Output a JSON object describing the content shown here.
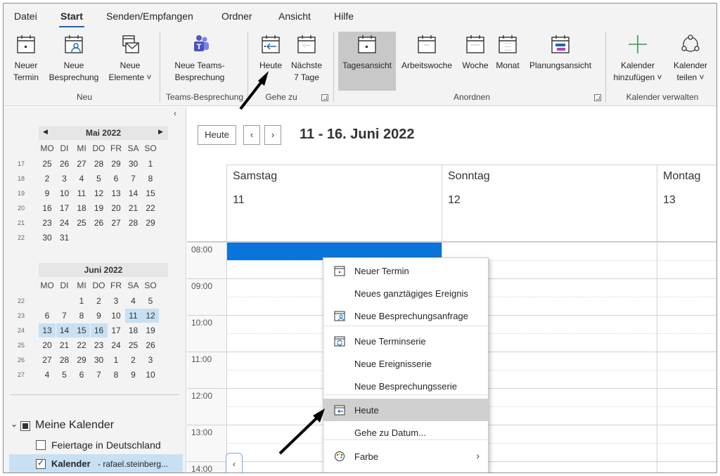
{
  "tabs": [
    "Datei",
    "Start",
    "Senden/Empfangen",
    "Ordner",
    "Ansicht",
    "Hilfe"
  ],
  "ribbon": {
    "neuer_termin": [
      "Neuer",
      "Termin"
    ],
    "neue_besprechung": [
      "Neue",
      "Besprechung"
    ],
    "neue_elemente": [
      "Neue",
      "Elemente ˅"
    ],
    "group_neu": "Neu",
    "teams": [
      "Neue Teams-",
      "Besprechung"
    ],
    "group_teams": "Teams-Besprechung",
    "heute": "Heute",
    "naechste": [
      "Nächste",
      "7 Tage"
    ],
    "group_gehe": "Gehe zu",
    "tagesansicht": "Tagesansicht",
    "arbeitswoche": "Arbeitswoche",
    "woche": "Woche",
    "monat": "Monat",
    "planungsansicht": "Planungsansicht",
    "group_anordnen": "Anordnen",
    "kal_hinzu": [
      "Kalender",
      "hinzufügen ˅"
    ],
    "kal_teilen": [
      "Kalender",
      "teilen ˅"
    ],
    "group_verwalten": "Kalender verwalten"
  },
  "mini_may": {
    "title": "Mai 2022",
    "weekdays": [
      "MO",
      "DI",
      "MI",
      "DO",
      "FR",
      "SA",
      "SO"
    ],
    "weeks": [
      {
        "wk": "17",
        "days": [
          "25",
          "26",
          "27",
          "28",
          "29",
          "30",
          "1"
        ]
      },
      {
        "wk": "18",
        "days": [
          "2",
          "3",
          "4",
          "5",
          "6",
          "7",
          "8"
        ]
      },
      {
        "wk": "19",
        "days": [
          "9",
          "10",
          "11",
          "12",
          "13",
          "14",
          "15"
        ]
      },
      {
        "wk": "20",
        "days": [
          "16",
          "17",
          "18",
          "19",
          "20",
          "21",
          "22"
        ]
      },
      {
        "wk": "21",
        "days": [
          "23",
          "24",
          "25",
          "26",
          "27",
          "28",
          "29"
        ]
      },
      {
        "wk": "22",
        "days": [
          "30",
          "31",
          "",
          "",
          "",
          "",
          ""
        ]
      }
    ]
  },
  "mini_june": {
    "title": "Juni 2022",
    "weekdays": [
      "MO",
      "DI",
      "MI",
      "DO",
      "FR",
      "SA",
      "SO"
    ],
    "weeks": [
      {
        "wk": "22",
        "days": [
          "",
          "",
          "1",
          "2",
          "3",
          "4",
          "5"
        ]
      },
      {
        "wk": "23",
        "days": [
          "6",
          "7",
          "8",
          "9",
          "10",
          "11",
          "12"
        ]
      },
      {
        "wk": "24",
        "days": [
          "13",
          "14",
          "15",
          "16",
          "17",
          "18",
          "19"
        ]
      },
      {
        "wk": "25",
        "days": [
          "20",
          "21",
          "22",
          "23",
          "24",
          "25",
          "26"
        ]
      },
      {
        "wk": "26",
        "days": [
          "27",
          "28",
          "29",
          "30",
          "1",
          "2",
          "3"
        ]
      },
      {
        "wk": "27",
        "days": [
          "4",
          "5",
          "6",
          "7",
          "8",
          "9",
          "10"
        ]
      }
    ]
  },
  "calendars": {
    "group": "Meine Kalender",
    "items": [
      "Feiertage in Deutschland"
    ],
    "active_name": "Kalender",
    "active_account": "- rafael.steinberg..."
  },
  "view": {
    "today_btn": "Heute",
    "range": "11 - 16. Juni 2022",
    "days": [
      {
        "name": "Samstag",
        "num": "11"
      },
      {
        "name": "Sonntag",
        "num": "12"
      },
      {
        "name": "Montag",
        "num": "13"
      }
    ],
    "hours": [
      "08:00",
      "09:00",
      "10:00",
      "11:00",
      "12:00",
      "13:00",
      "14:00"
    ]
  },
  "context_menu": [
    {
      "label": "Neuer Termin",
      "icon": "calendar-icon"
    },
    {
      "label": "Neues ganztägiges Ereignis",
      "icon": ""
    },
    {
      "label": "Neue Besprechungsanfrage",
      "icon": "meeting-icon"
    },
    {
      "label": "Neue Terminserie",
      "icon": "recurring-icon"
    },
    {
      "label": "Neue Ereignisserie",
      "icon": ""
    },
    {
      "label": "Neue Besprechungsserie",
      "icon": ""
    },
    {
      "label": "Heute",
      "icon": "today-icon"
    },
    {
      "label": "Gehe zu Datum...",
      "icon": ""
    },
    {
      "label": "Farbe",
      "icon": "palette-icon"
    }
  ],
  "colors": {
    "accent": "#0f6cbd",
    "event": "#0a74da",
    "selection": "#c7e0f4"
  }
}
